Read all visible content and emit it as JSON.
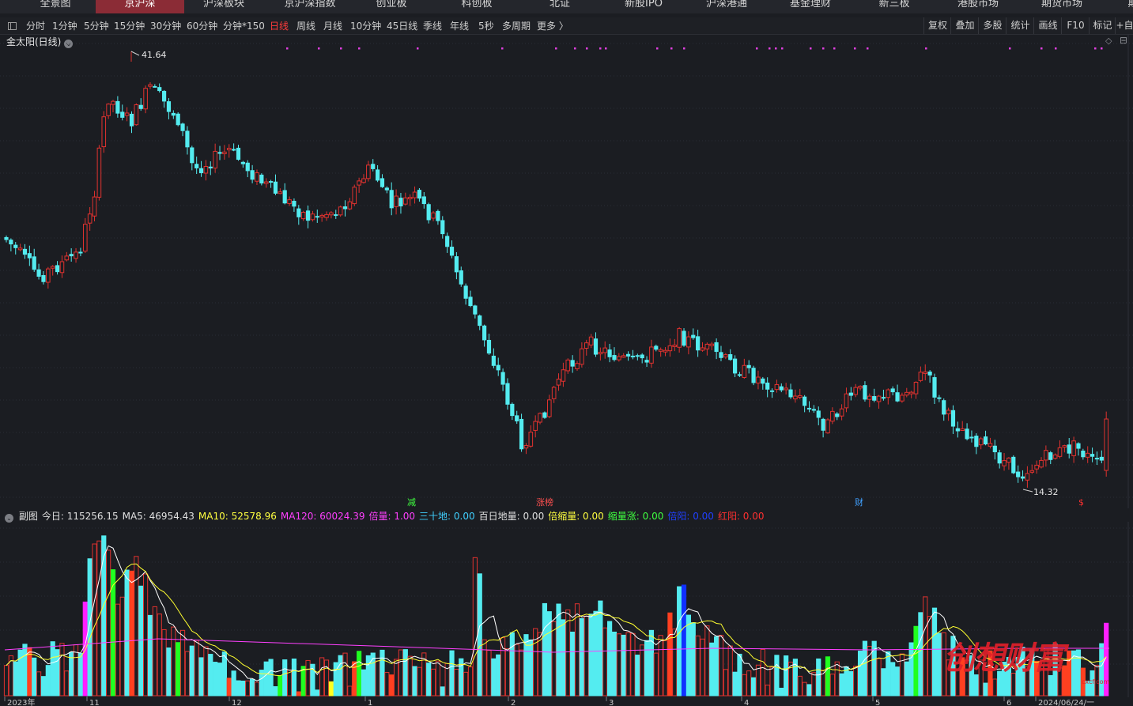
{
  "nav": {
    "items": [
      "全景图",
      "京沪深",
      "沪深板块",
      "京沪深指数",
      "创业板",
      "科创板",
      "北证",
      "新股IPO",
      "沪深港通",
      "基金理财",
      "新三板",
      "港股市场",
      "期货市场",
      "期"
    ],
    "active_index": 1
  },
  "toolbar": {
    "periods": [
      "分时",
      "1分钟",
      "5分钟",
      "15分钟",
      "30分钟",
      "60分钟",
      "分钟*150",
      "日线",
      "周线",
      "月线",
      "10分钟",
      "45日线",
      "季线",
      "年线",
      "5秒",
      "多周期",
      "更多 〉"
    ],
    "active_index": 7,
    "right": [
      "复权",
      "叠加",
      "多股",
      "统计",
      "画线",
      "F10",
      "标记",
      "+自"
    ]
  },
  "main_chart": {
    "title": "金太阳(日线)",
    "high_label": "41.64",
    "low_label": "14.32",
    "markers": [
      {
        "text": "减",
        "color": "#40ff40"
      },
      {
        "text": "涨榜",
        "color": "#ff5050"
      },
      {
        "text": "财",
        "color": "#40a0ff"
      },
      {
        "text": "$",
        "color": "#ff3030"
      }
    ]
  },
  "sub_chart": {
    "header": [
      {
        "text": "副图",
        "color": "#e0e0e0"
      },
      {
        "text": "今日: 115256.15",
        "color": "#e0e0e0"
      },
      {
        "text": "MA5: 46954.43",
        "color": "#e0e0e0"
      },
      {
        "text": "MA10: 52578.96",
        "color": "#ffff40"
      },
      {
        "text": "MA120: 60024.39",
        "color": "#ff40ff"
      },
      {
        "text": "倍量: 1.00",
        "color": "#ff40ff"
      },
      {
        "text": "三十地: 0.00",
        "color": "#40d0ff"
      },
      {
        "text": "百日地量: 0.00",
        "color": "#e0e0e0"
      },
      {
        "text": "倍缩量: 0.00",
        "color": "#ffff40"
      },
      {
        "text": "缩量涨: 0.00",
        "color": "#40ff40"
      },
      {
        "text": "倍阳: 0.00",
        "color": "#2040ff"
      },
      {
        "text": "红阳: 0.00",
        "color": "#ff3030"
      }
    ],
    "axis_labels": [
      "2023年",
      "11",
      "12",
      "1",
      "2",
      "3",
      "4",
      "5",
      "6",
      "2024/06/24/一"
    ]
  },
  "colors": {
    "up": "#e0322f",
    "down": "#54ecf0",
    "bg": "#1b1d22"
  },
  "watermark": {
    "text": "创想财富",
    "url": "cxcf.com"
  }
}
